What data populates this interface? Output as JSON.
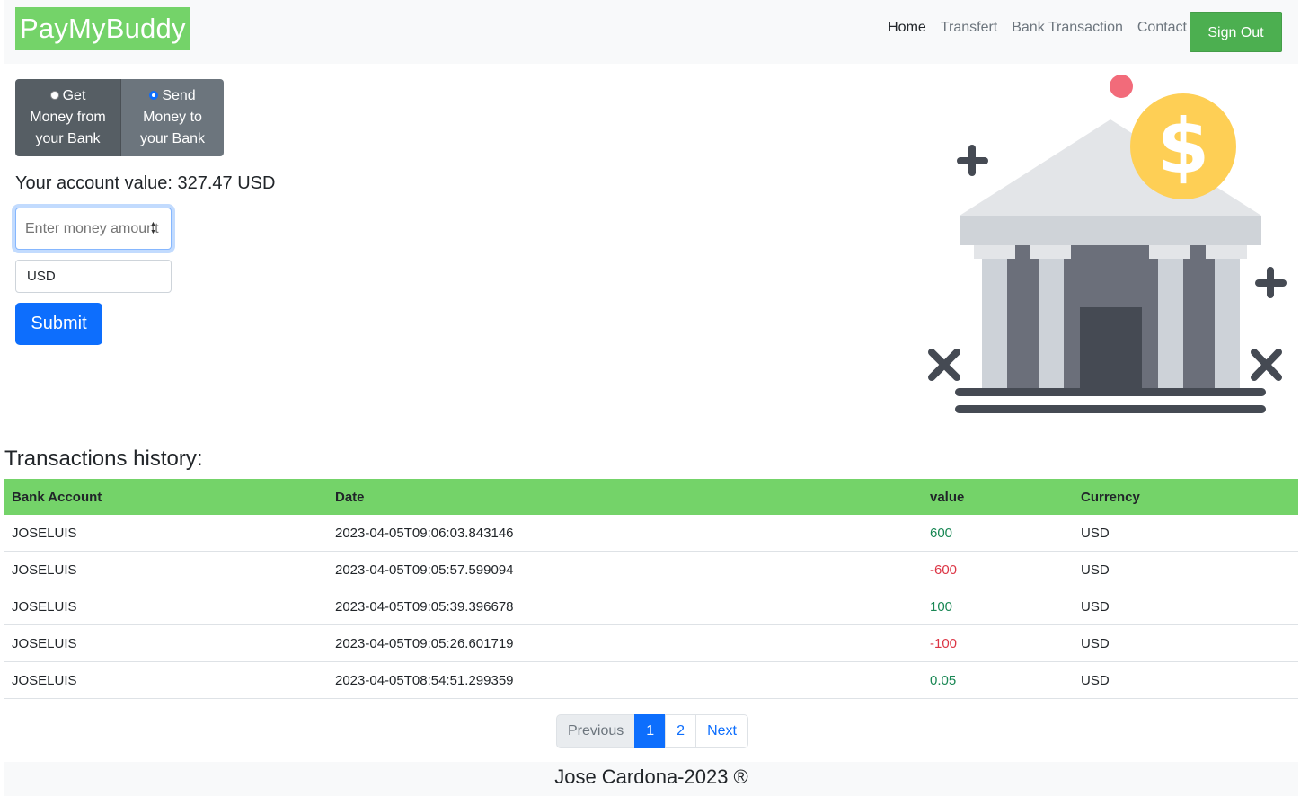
{
  "navbar": {
    "brand": "PayMyBuddy",
    "links": [
      "Home",
      "Transfert",
      "Bank Transaction",
      "Contact"
    ],
    "sign_out": "Sign Out"
  },
  "form": {
    "options": {
      "get_line1": "Get",
      "get_line2": "Money from",
      "get_line3": "your Bank",
      "send_line1": "Send",
      "send_line2": "Money to",
      "send_line3": "your Bank",
      "selected": "send"
    },
    "account_value_label": "Your account value: 327.47 USD",
    "amount_placeholder": "Enter money amount",
    "currency": "USD",
    "submit_label": "Submit"
  },
  "history": {
    "title": "Transactions history:",
    "columns": [
      "Bank Account",
      "Date",
      "value",
      "Currency"
    ],
    "rows": [
      {
        "account": "JOSELUIS",
        "date": "2023-04-05T09:06:03.843146",
        "value": "600",
        "currency": "USD",
        "sign": "positive"
      },
      {
        "account": "JOSELUIS",
        "date": "2023-04-05T09:05:57.599094",
        "value": "-600",
        "currency": "USD",
        "sign": "negative"
      },
      {
        "account": "JOSELUIS",
        "date": "2023-04-05T09:05:39.396678",
        "value": "100",
        "currency": "USD",
        "sign": "positive"
      },
      {
        "account": "JOSELUIS",
        "date": "2023-04-05T09:05:26.601719",
        "value": "-100",
        "currency": "USD",
        "sign": "negative"
      },
      {
        "account": "JOSELUIS",
        "date": "2023-04-05T08:54:51.299359",
        "value": "0.05",
        "currency": "USD",
        "sign": "positive"
      }
    ]
  },
  "pagination": {
    "previous": "Previous",
    "pages": [
      "1",
      "2"
    ],
    "current": "1",
    "next": "Next"
  },
  "footer": {
    "text": "Jose Cardona-2023 ®"
  },
  "colors": {
    "brand_green": "#74d369",
    "sign_out_green": "#4caf50",
    "primary_blue": "#0d6efd",
    "positive": "#198754",
    "negative": "#dc3545"
  },
  "icons": {
    "illustration": "bank-building-dollar-icon"
  }
}
